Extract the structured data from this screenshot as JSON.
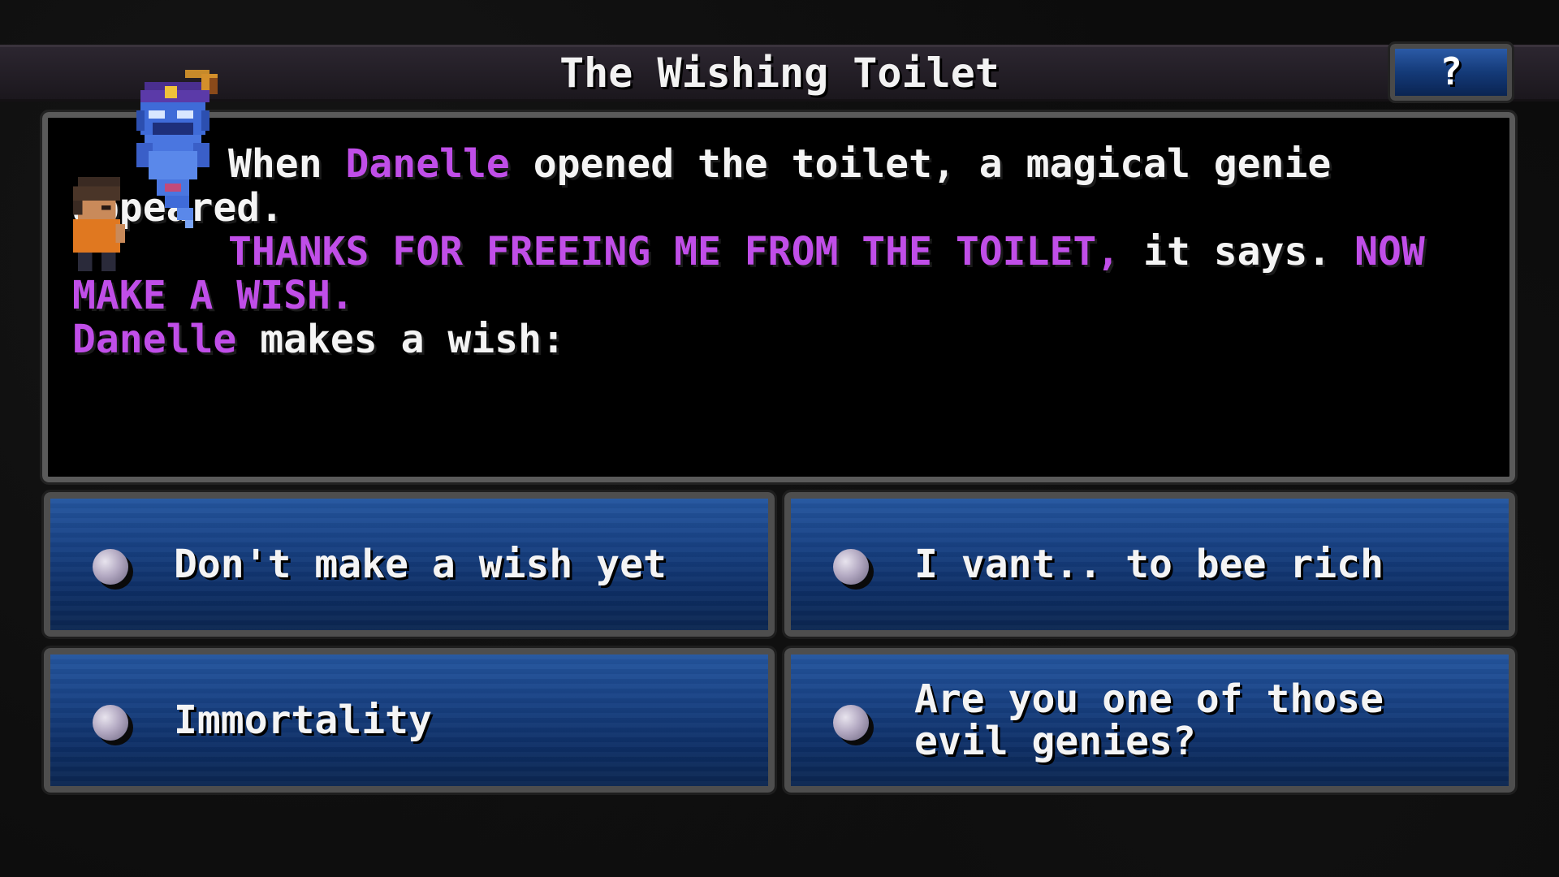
{
  "event": {
    "title": "The Wishing Toilet",
    "help_label": "?"
  },
  "dialog": {
    "line1_pre": "When ",
    "name": "Danelle",
    "line1_post": " opened the toilet, a magical genie appeared.",
    "genie_quote_1": "THANKS FOR FREEING ME FROM THE TOILET,",
    "it_says": " it says. ",
    "genie_quote_2": "NOW MAKE A WISH.",
    "name2": "Danelle",
    "line3_post": " makes a wish:"
  },
  "choices": [
    {
      "label": "Don't make a wish yet",
      "icon": "orb-icon"
    },
    {
      "label": "I vant.. to bee rich",
      "icon": "orb-icon"
    },
    {
      "label": "Immortality",
      "icon": "orb-icon"
    },
    {
      "label": "Are you one of those evil genies?",
      "icon": "orb-icon"
    }
  ],
  "colors": {
    "highlight_purple": "#c04ee8",
    "button_blue": "#173f80"
  }
}
